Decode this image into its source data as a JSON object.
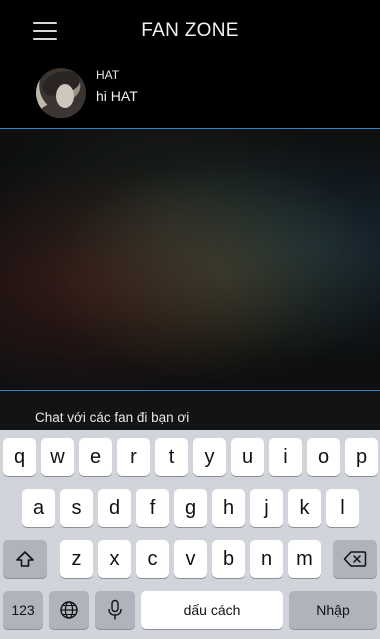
{
  "header": {
    "title": "FAN ZONE",
    "menu_icon": "hamburger-menu-icon"
  },
  "message": {
    "name": "HAT",
    "text": "hi HAT",
    "avatar_icon": "user-avatar"
  },
  "input": {
    "value": "Chat với các fan đi bạn ơi"
  },
  "keyboard": {
    "row1": [
      "q",
      "w",
      "e",
      "r",
      "t",
      "y",
      "u",
      "i",
      "o",
      "p"
    ],
    "row2": [
      "a",
      "s",
      "d",
      "f",
      "g",
      "h",
      "j",
      "k",
      "l"
    ],
    "row3": [
      "z",
      "x",
      "c",
      "v",
      "b",
      "n",
      "m"
    ],
    "numbers_label": "123",
    "space_label": "dấu cách",
    "return_label": "Nhập"
  },
  "colors": {
    "divider": "#2e86c9",
    "keyboard_bg": "#d1d4da"
  }
}
